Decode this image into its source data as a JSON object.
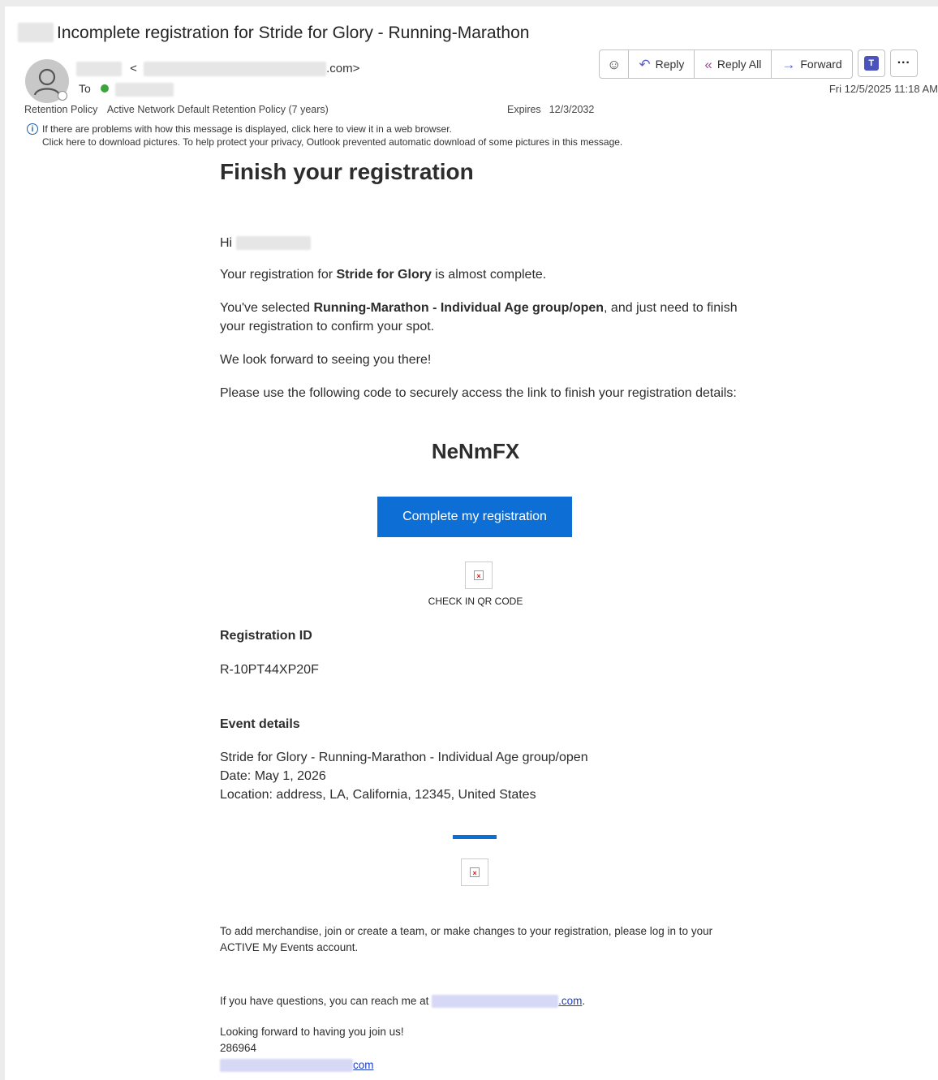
{
  "email": {
    "subject": "Incomplete registration for Stride for Glory - Running-Marathon",
    "from_suffix": ".com>",
    "from_open": "<",
    "to_label": "To",
    "date": "Fri 12/5/2025 11:18 AM",
    "retention_label": "Retention Policy",
    "retention_value": "Active Network Default Retention Policy (7 years)",
    "expires_label": "Expires",
    "expires_value": "12/3/2032",
    "info_line1": "If there are problems with how this message is displayed, click here to view it in a web browser.",
    "info_line2": "Click here to download pictures. To help protect your privacy, Outlook prevented automatic download of some pictures in this message."
  },
  "toolbar": {
    "reply": "Reply",
    "reply_all": "Reply All",
    "forward": "Forward"
  },
  "body": {
    "heading": "Finish your registration",
    "greeting": "Hi",
    "p1_pre": "Your registration for ",
    "p1_bold": "Stride for Glory",
    "p1_post": " is almost complete.",
    "p2_pre": "You've selected ",
    "p2_bold": "Running-Marathon - Individual Age group/open",
    "p2_post": ", and just need to finish your registration to confirm your spot.",
    "p3": "We look forward to seeing you there!",
    "p4": "Please use the following code to securely access the link to finish your registration details:",
    "code": "NeNmFX",
    "cta": "Complete my registration",
    "qr_label": "CHECK IN QR CODE",
    "reg_id_label": "Registration ID",
    "reg_id": "R-10PT44XP20F",
    "event_label": "Event details",
    "event_line1": "Stride for Glory - Running-Marathon - Individual Age group/open",
    "event_line2": "Date: May 1, 2026",
    "event_line3": "Location: address, LA, California, 12345, United States",
    "footer1": "To add merchandise, join or create a team, or make changes to your registration, please log in to your ACTIVE My Events account.",
    "footer2_pre": "If you have questions, you can reach me at ",
    "footer2_link": ".com",
    "footer2_post": ".",
    "footer3": "Looking forward to having you join us!",
    "footer4": "286964",
    "footer5_link": "com"
  }
}
